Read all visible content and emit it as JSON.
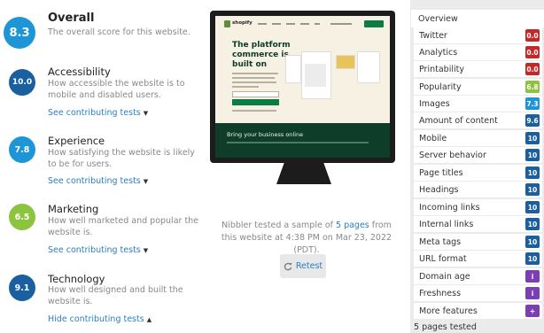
{
  "sections": [
    {
      "score": "8.3",
      "title": "Overall",
      "desc_lines": [
        "The overall score for this website."
      ],
      "link": "",
      "caret": "",
      "color": "#1e95d6"
    },
    {
      "score": "10.0",
      "title": "Accessibility",
      "desc_lines": [
        "How accessible the website is to",
        "mobile and disabled users."
      ],
      "link": "See contributing tests",
      "caret": "▼",
      "color": "#1a5fa0"
    },
    {
      "score": "7.8",
      "title": "Experience",
      "desc_lines": [
        "How satisfying the website is likely",
        "to be for users."
      ],
      "link": "See contributing tests",
      "caret": "▼",
      "color": "#1e95d6"
    },
    {
      "score": "6.5",
      "title": "Marketing",
      "desc_lines": [
        "How well marketed and popular the",
        "website is."
      ],
      "link": "See contributing tests",
      "caret": "▼",
      "color": "#8dc43f"
    },
    {
      "score": "9.1",
      "title": "Technology",
      "desc_lines": [
        "How well designed and built the",
        "website is."
      ],
      "link": "Hide contributing tests",
      "caret": "▲",
      "color": "#1a5fa0"
    }
  ],
  "preview": {
    "logo": "shopify",
    "headline_lines": [
      "The platform",
      "commerce is",
      "built on"
    ],
    "band_text": "Bring your business online"
  },
  "nibbler": {
    "pre": "Nibbler tested a sample of ",
    "link": "5 pages",
    "post": " from this website at 4:38 PM on Mar 23, 2022 (PDT)."
  },
  "retest_label": "Retest",
  "sidebar": {
    "overview": "Overview",
    "items": [
      {
        "label": "Twitter",
        "score": "0.0",
        "color": "#c62828"
      },
      {
        "label": "Analytics",
        "score": "0.0",
        "color": "#c62828"
      },
      {
        "label": "Printability",
        "score": "0.0",
        "color": "#c62828"
      },
      {
        "label": "Popularity",
        "score": "6.8",
        "color": "#8dc43f"
      },
      {
        "label": "Images",
        "score": "7.3",
        "color": "#1e95d6"
      },
      {
        "label": "Amount of content",
        "score": "9.6",
        "color": "#1a5fa0"
      },
      {
        "label": "Mobile",
        "score": "10",
        "color": "#1a5fa0"
      },
      {
        "label": "Server behavior",
        "score": "10",
        "color": "#1a5fa0"
      },
      {
        "label": "Page titles",
        "score": "10",
        "color": "#1a5fa0"
      },
      {
        "label": "Headings",
        "score": "10",
        "color": "#1a5fa0"
      },
      {
        "label": "Incoming links",
        "score": "10",
        "color": "#1a5fa0"
      },
      {
        "label": "Internal links",
        "score": "10",
        "color": "#1a5fa0"
      },
      {
        "label": "Meta tags",
        "score": "10",
        "color": "#1a5fa0"
      },
      {
        "label": "URL format",
        "score": "10",
        "color": "#1a5fa0"
      },
      {
        "label": "Domain age",
        "score": "i",
        "color": "#7b3fb3"
      },
      {
        "label": "Freshness",
        "score": "i",
        "color": "#7b3fb3"
      },
      {
        "label": "More features",
        "score": "+",
        "color": "#7b3fb3"
      }
    ],
    "tested": "5 pages tested"
  }
}
